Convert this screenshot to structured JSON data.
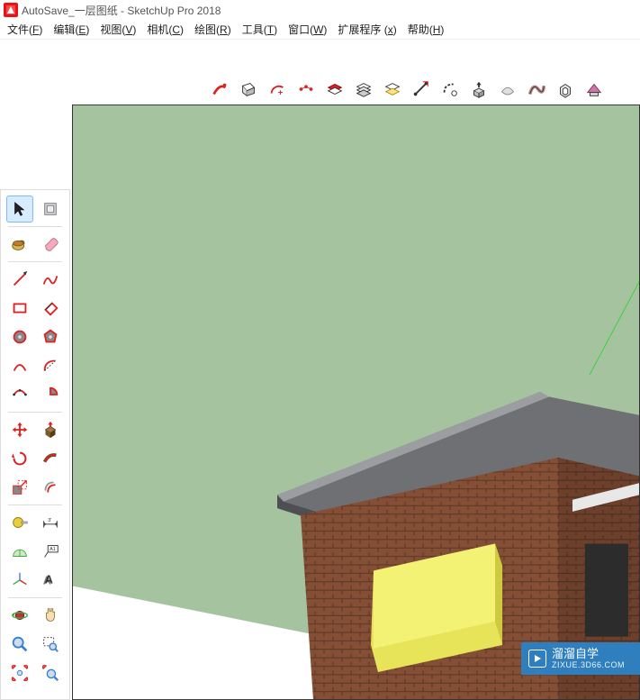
{
  "title": "AutoSave_一层图纸 - SketchUp Pro 2018",
  "menus": [
    {
      "label": "文件",
      "key": "F"
    },
    {
      "label": "编辑",
      "key": "E"
    },
    {
      "label": "视图",
      "key": "V"
    },
    {
      "label": "相机",
      "key": "C"
    },
    {
      "label": "绘图",
      "key": "R"
    },
    {
      "label": "工具",
      "key": "T"
    },
    {
      "label": "窗口",
      "key": "W"
    },
    {
      "label": "扩展程序 ",
      "key": "x"
    },
    {
      "label": "帮助",
      "key": "H"
    }
  ],
  "top_tools": [
    {
      "name": "fredo-tool-icon"
    },
    {
      "name": "face-icon"
    },
    {
      "name": "arc-add-icon"
    },
    {
      "name": "weld-icon"
    },
    {
      "name": "layer-color-icon"
    },
    {
      "name": "layers-icon"
    },
    {
      "name": "layers-iso-icon"
    },
    {
      "name": "edge-tool-icon"
    },
    {
      "name": "bevel-icon"
    },
    {
      "name": "extrude-icon"
    },
    {
      "name": "soften-icon"
    },
    {
      "name": "curve-icon"
    },
    {
      "name": "shell-icon"
    },
    {
      "name": "roof-icon"
    }
  ],
  "left_tools": [
    [
      {
        "name": "select-tool-icon",
        "selected": true
      },
      {
        "name": "lasso-select-icon"
      }
    ],
    "sep",
    [
      {
        "name": "paint-bucket-icon"
      },
      {
        "name": "eraser-icon"
      }
    ],
    "sep",
    [
      {
        "name": "line-tool-icon"
      },
      {
        "name": "freehand-icon"
      }
    ],
    [
      {
        "name": "rectangle-icon"
      },
      {
        "name": "rotated-rect-icon"
      }
    ],
    [
      {
        "name": "circle-icon"
      },
      {
        "name": "polygon-icon"
      }
    ],
    [
      {
        "name": "arc-icon"
      },
      {
        "name": "arc2-icon"
      }
    ],
    [
      {
        "name": "arc3-icon"
      },
      {
        "name": "pie-icon"
      }
    ],
    "sep",
    [
      {
        "name": "move-tool-icon"
      },
      {
        "name": "pushpull-icon"
      }
    ],
    [
      {
        "name": "rotate-tool-icon"
      },
      {
        "name": "followme-icon"
      }
    ],
    [
      {
        "name": "scale-tool-icon"
      },
      {
        "name": "offset-icon"
      }
    ],
    "sep",
    [
      {
        "name": "tape-measure-icon"
      },
      {
        "name": "dimension-icon"
      }
    ],
    [
      {
        "name": "protractor-icon"
      },
      {
        "name": "text-icon"
      }
    ],
    [
      {
        "name": "axes-icon"
      },
      {
        "name": "3dtext-icon"
      }
    ],
    "sep",
    [
      {
        "name": "orbit-icon"
      },
      {
        "name": "pan-icon"
      }
    ],
    [
      {
        "name": "zoom-icon"
      },
      {
        "name": "zoom-window-icon"
      }
    ],
    [
      {
        "name": "zoom-extents-icon"
      },
      {
        "name": "previous-view-icon"
      }
    ]
  ],
  "watermark": {
    "brand": "溜溜自学",
    "url": "ZIXUE.3D66.COM"
  }
}
